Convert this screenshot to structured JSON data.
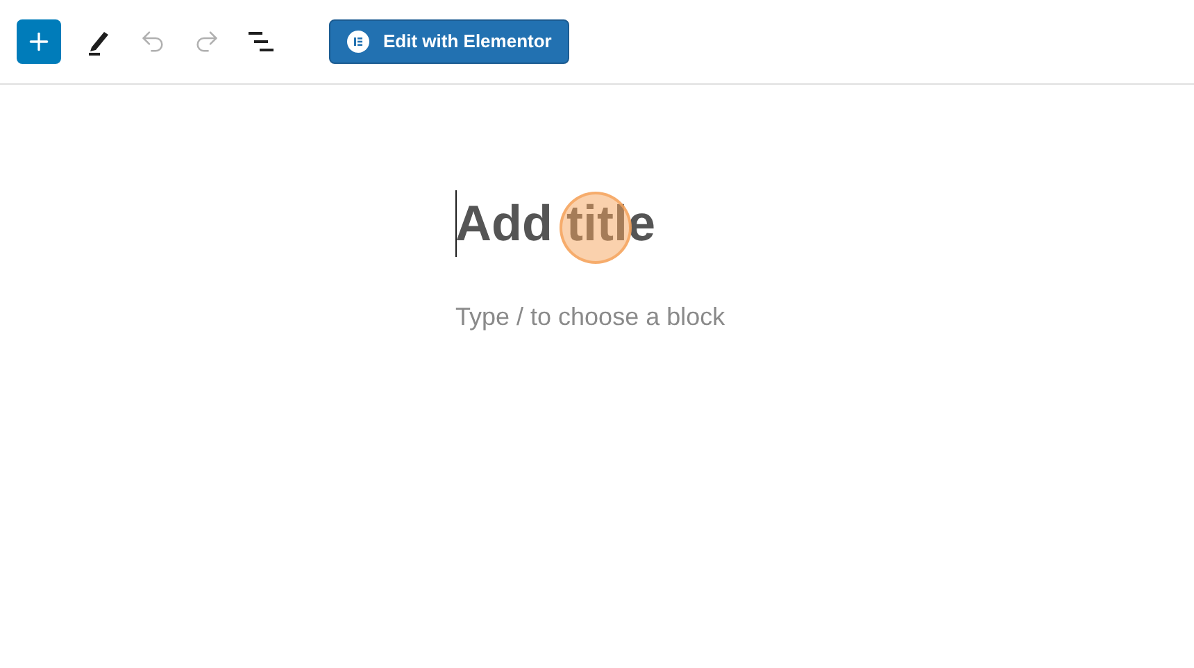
{
  "toolbar": {
    "tools": [
      {
        "kind": "add",
        "disabled": false
      },
      {
        "kind": "pen",
        "disabled": false
      },
      {
        "kind": "undo",
        "disabled": true
      },
      {
        "kind": "redo",
        "disabled": true
      },
      {
        "kind": "outline",
        "disabled": false
      }
    ],
    "elementor_button": {
      "label": "Edit with Elementor"
    }
  },
  "editor": {
    "title": {
      "placeholder": "Add title"
    },
    "block": {
      "placeholder": "Type / to choose a block"
    }
  }
}
